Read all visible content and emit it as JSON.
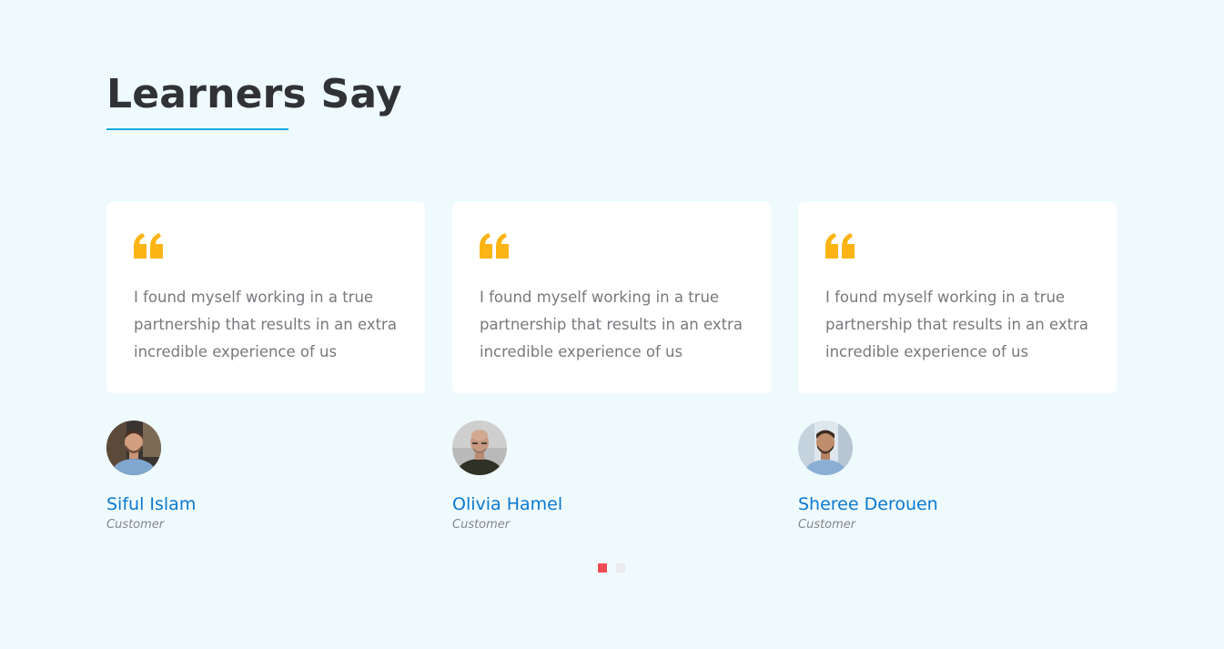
{
  "section": {
    "title": "Learners Say"
  },
  "colors": {
    "background": "#effafc",
    "accent_underline": "#1ba9e0",
    "quote_icon": "#fcb415",
    "name": "#0b79d0",
    "dot_active": "#f04b55",
    "dot_inactive": "#ecebef"
  },
  "testimonials": [
    {
      "quote": "I found myself working in a true partnership that results in an extra incredible experience of us",
      "name": "Siful Islam",
      "role": "Customer",
      "icon": "quote-icon"
    },
    {
      "quote": "I found myself working in a true partnership that results in an extra incredible experience of us",
      "name": "Olivia Hamel",
      "role": "Customer",
      "icon": "quote-icon"
    },
    {
      "quote": "I found myself working in a true partnership that results in an extra incredible experience of us",
      "name": "Sheree Derouen",
      "role": "Customer",
      "icon": "quote-icon"
    }
  ],
  "pagination": {
    "pages": 2,
    "active": 1
  }
}
